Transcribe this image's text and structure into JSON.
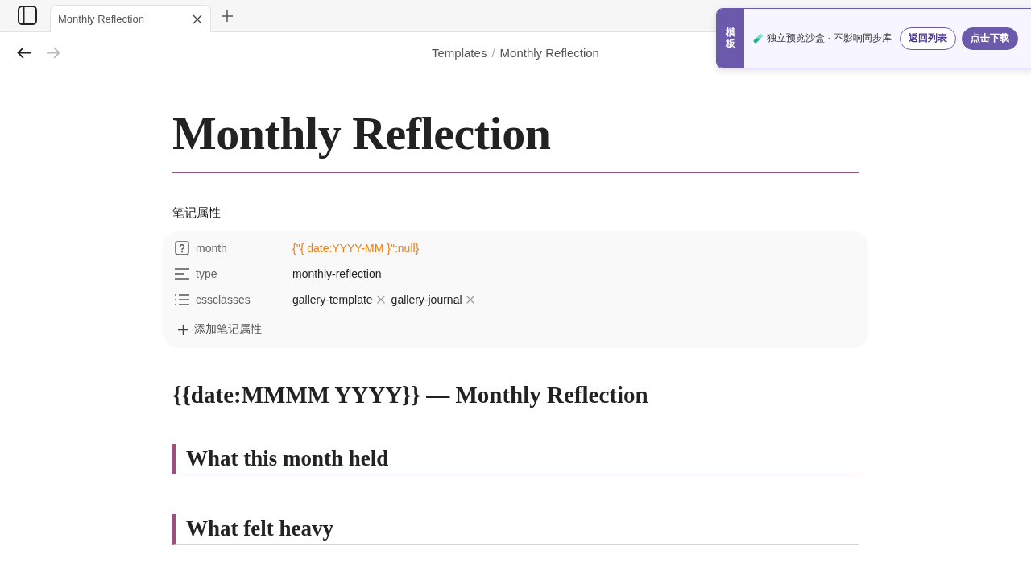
{
  "tab_bar": {
    "tabs": [
      {
        "title": "Monthly Reflection",
        "selected": true
      }
    ]
  },
  "nav": {
    "buttons": [
      {
        "kind": "back",
        "disabled": false
      },
      {
        "kind": "forward",
        "disabled": true
      }
    ],
    "breadcrumb": {
      "path": [
        "Templates"
      ],
      "separator": "/",
      "current": "Monthly Reflection"
    }
  },
  "note": {
    "title": "Monthly Reflection",
    "properties": {
      "heading": "笔记属性",
      "items": [
        {
          "kind": "unknown",
          "key": "month",
          "value": "{\"{ date:YYYY-MM }\":null}",
          "invalid": true
        },
        {
          "kind": "text",
          "key": "type",
          "value": "monthly-reflection",
          "invalid": false
        },
        {
          "kind": "list",
          "key": "cssclasses",
          "values": [
            "gallery-template",
            "gallery-journal"
          ]
        }
      ],
      "add_label": "添加笔记属性"
    },
    "blocks": [
      {
        "kind": "h2",
        "text": "{{date:MMMM YYYY}} — Monthly Reflection"
      },
      {
        "kind": "h3",
        "text": "What this month held"
      },
      {
        "kind": "h3",
        "text": "What felt heavy"
      }
    ]
  },
  "banner": {
    "tag": "模板",
    "message": "独立预览沙盒 · 不影响同步库",
    "buttons": [
      {
        "kind": "outline",
        "label": "返回列表"
      },
      {
        "kind": "primary",
        "label": "点击下载"
      }
    ]
  }
}
